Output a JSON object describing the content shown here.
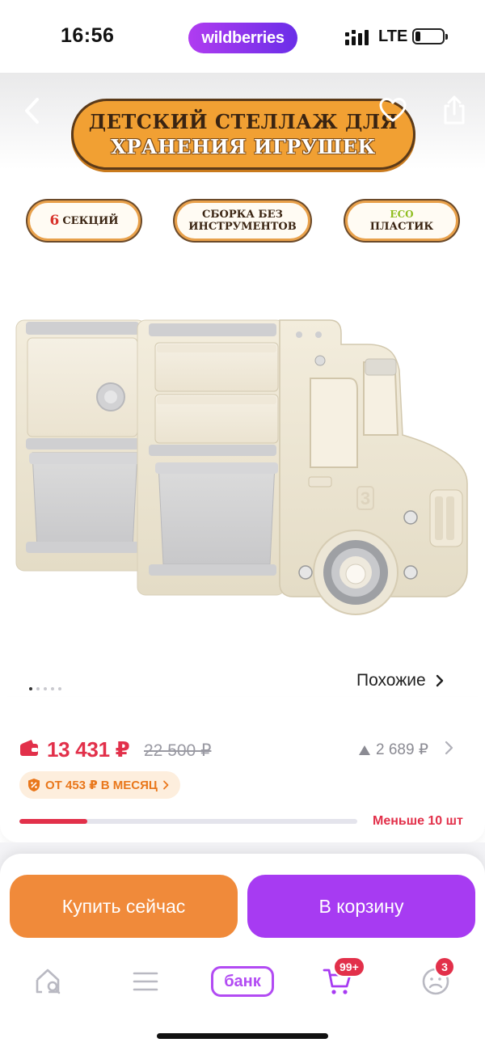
{
  "status_bar": {
    "time": "16:56",
    "brand": "wildberries",
    "network": "LTE",
    "battery_level": 0.2
  },
  "gallery": {
    "banner_line1": "ДЕТСКИЙ СТЕЛЛАЖ ДЛЯ",
    "banner_line2": "ХРАНЕНИЯ ИГРУШЕК",
    "badges": [
      {
        "accent": "6",
        "text": "СЕКЦИЙ"
      },
      {
        "line1": "СБОРКА БЕЗ",
        "line2": "ИНСТРУМЕНТОВ"
      },
      {
        "accent": "ECO",
        "text": "ПЛАСТИК"
      }
    ],
    "truck_number": "3",
    "pager": {
      "total": 5,
      "active": 1
    },
    "similar_label": "Похожие",
    "icons": [
      "chevron-left-icon",
      "heart-icon",
      "share-icon",
      "chevron-right-icon"
    ]
  },
  "price": {
    "current": "13 431 ₽",
    "old": "22 500 ₽",
    "diff": "2 689 ₽",
    "installment": "ОТ 453 ₽ В МЕСЯЦ",
    "stock_label": "Меньше 10 шт",
    "stock_fill_percent": 20,
    "accent_color": "#e2304a",
    "installment_color": "#e9771b"
  },
  "actions": {
    "buy_now": "Купить сейчас",
    "to_cart": "В корзину",
    "buy_now_color": "#f08a3a",
    "to_cart_color": "#a73bf2"
  },
  "tab_bar": {
    "bank_label": "банк",
    "cart_count": "99+",
    "profile_count": "3",
    "icons": [
      "home-search-icon",
      "menu-icon",
      "cart-icon",
      "profile-icon"
    ]
  }
}
